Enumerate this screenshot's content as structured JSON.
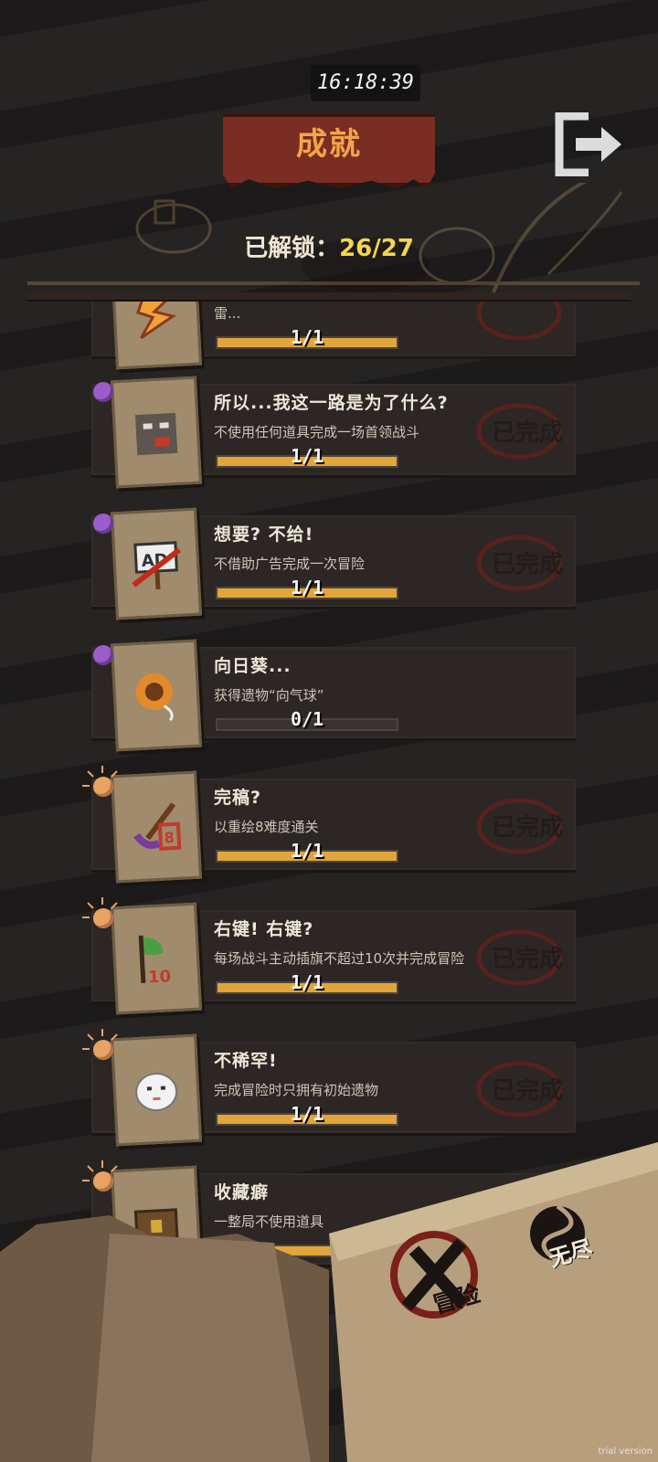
{
  "clock": "16:18:39",
  "title": "成就",
  "unlock": {
    "label": "已解锁：",
    "count": "26/27"
  },
  "stamp_text": "已完成",
  "achievements": [
    {
      "name": "",
      "desc": "雷...",
      "progress_text": "1/1",
      "progress": 1,
      "pin": "orange",
      "icon": "thunder-icon",
      "completed": true
    },
    {
      "name": "所以...我这一路是为了什么?",
      "desc": "不使用任何道具完成一场首领战斗",
      "progress_text": "1/1",
      "progress": 1,
      "pin": "purple",
      "icon": "sad-face-icon",
      "completed": true
    },
    {
      "name": "想要? 不给!",
      "desc": "不借助广告完成一次冒险",
      "progress_text": "1/1",
      "progress": 1,
      "pin": "purple",
      "icon": "ad-sign-icon",
      "completed": true
    },
    {
      "name": "向日葵...",
      "desc": "获得遗物“向气球”",
      "progress_text": "0/1",
      "progress": 0,
      "pin": "purple",
      "icon": "sunflower-icon",
      "completed": false
    },
    {
      "name": "完稿?",
      "desc": "以重绘8难度通关",
      "progress_text": "1/1",
      "progress": 1,
      "pin": "orange",
      "icon": "paint-brush-icon",
      "completed": true
    },
    {
      "name": "右键! 右键?",
      "desc": "每场战斗主动插旗不超过10次并完成冒险",
      "progress_text": "1/1",
      "progress": 1,
      "pin": "orange",
      "icon": "flag-icon",
      "completed": true
    },
    {
      "name": "不稀罕!",
      "desc": "完成冒险时只拥有初始遗物",
      "progress_text": "1/1",
      "progress": 1,
      "pin": "orange",
      "icon": "ghost-icon",
      "completed": true
    },
    {
      "name": "收藏癖",
      "desc": "一整局不使用道具",
      "progress_text": "1/1",
      "progress": 1,
      "pin": "orange",
      "icon": "chest-icon",
      "completed": true
    }
  ],
  "bottom": {
    "adventure_label": "冒险",
    "endless_label": "无尽"
  },
  "trial_label": "trial version"
}
